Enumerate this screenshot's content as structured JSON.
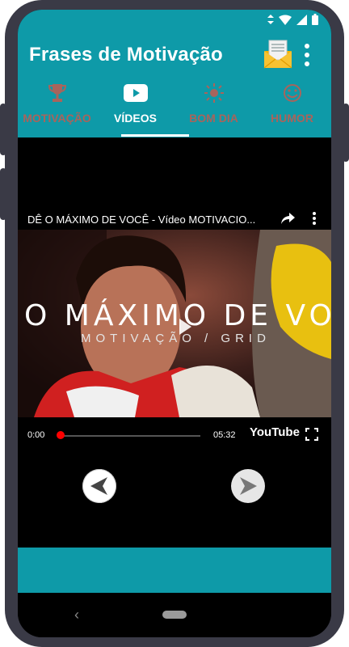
{
  "app": {
    "title": "Frases de Motivação"
  },
  "status_bar": {
    "icons": [
      "data-arrows-icon",
      "wifi-icon",
      "signal-icon",
      "battery-icon"
    ]
  },
  "header_actions": {
    "mail_icon": "envelope-icon",
    "menu_icon": "overflow-menu-icon"
  },
  "tabs": [
    {
      "label": "MOTIVAÇÃO",
      "icon": "trophy-icon",
      "active": false
    },
    {
      "label": "VÍDEOS",
      "icon": "youtube-play-icon",
      "active": true
    },
    {
      "label": "BOM DIA",
      "icon": "sun-icon",
      "active": false
    },
    {
      "label": "HUMOR",
      "icon": "smiley-icon",
      "active": false
    }
  ],
  "video": {
    "title": "DÊ O MÁXIMO DE VOCÊ - Vídeo MOTIVACIO...",
    "overlay_main": "O MÁXIMO DE VOCÊ",
    "overlay_sub": "MOTIVAÇÃO / GRID",
    "current_time": "0:00",
    "duration": "05:32",
    "progress": 0.0,
    "brand": "YouTube"
  },
  "colors": {
    "accent": "#0e9aa8",
    "tab_inactive": "#a8645c",
    "progress": "#ff0000",
    "frame_body": "#3a3a46"
  }
}
